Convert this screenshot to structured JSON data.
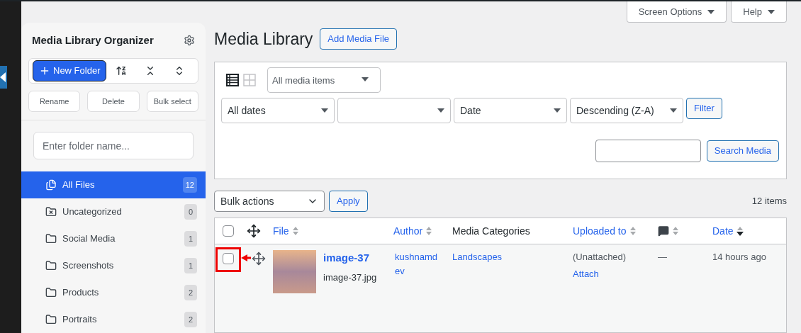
{
  "header": {
    "screen_options": "Screen Options",
    "help": "Help",
    "title": "Media Library",
    "add_button": "Add Media File"
  },
  "sidebar": {
    "title": "Media Library Organizer",
    "new_folder": "New Folder",
    "actions": [
      "Rename",
      "Delete",
      "Bulk select"
    ],
    "search": {
      "placeholder": "Enter folder name..."
    },
    "folders": [
      {
        "kind": "all",
        "name": "All Files",
        "count": "12",
        "selected": true
      },
      {
        "kind": "uncategorized",
        "name": "Uncategorized",
        "count": "0",
        "selected": false
      },
      {
        "kind": "folder",
        "name": "Social Media",
        "count": "1",
        "selected": false
      },
      {
        "kind": "folder",
        "name": "Screenshots",
        "count": "1",
        "selected": false
      },
      {
        "kind": "folder",
        "name": "Products",
        "count": "2",
        "selected": false
      },
      {
        "kind": "folder",
        "name": "Portraits",
        "count": "2",
        "selected": false
      }
    ]
  },
  "filters": {
    "view_modes": [
      {
        "kind": "list",
        "selected": true
      },
      {
        "kind": "grid",
        "selected": false
      }
    ],
    "media_type": "All media items",
    "dates": "All dates",
    "orderby": "Date",
    "order": "Descending (Z-A)",
    "filter_button": "Filter",
    "search_button": "Search Media"
  },
  "bulk": {
    "action": "Bulk actions",
    "apply": "Apply",
    "count": "12 items"
  },
  "table": {
    "columns": [
      {
        "kind": "check",
        "checked": false
      },
      {
        "kind": "move"
      },
      {
        "kind": "text",
        "label": "File",
        "sortable": true,
        "sorted": false
      },
      {
        "kind": "text",
        "label": "Author",
        "sortable": true,
        "sorted": false
      },
      {
        "kind": "text",
        "label": "Media Categories",
        "sortable": false
      },
      {
        "kind": "text",
        "label": "Uploaded to",
        "sortable": true,
        "sorted": false
      },
      {
        "kind": "comments",
        "sortable": true,
        "sorted": false
      },
      {
        "kind": "text",
        "label": "Date",
        "sortable": true,
        "sorted": true
      }
    ],
    "rows": [
      {
        "selected": false,
        "highlighted": true,
        "title": "image-37",
        "filename": "image-37.jpg",
        "author": "kushnamdev",
        "category": "Landscapes",
        "uploaded": "(Unattached)",
        "attach": "Attach",
        "comments": "—",
        "date": "14 hours ago"
      }
    ]
  }
}
